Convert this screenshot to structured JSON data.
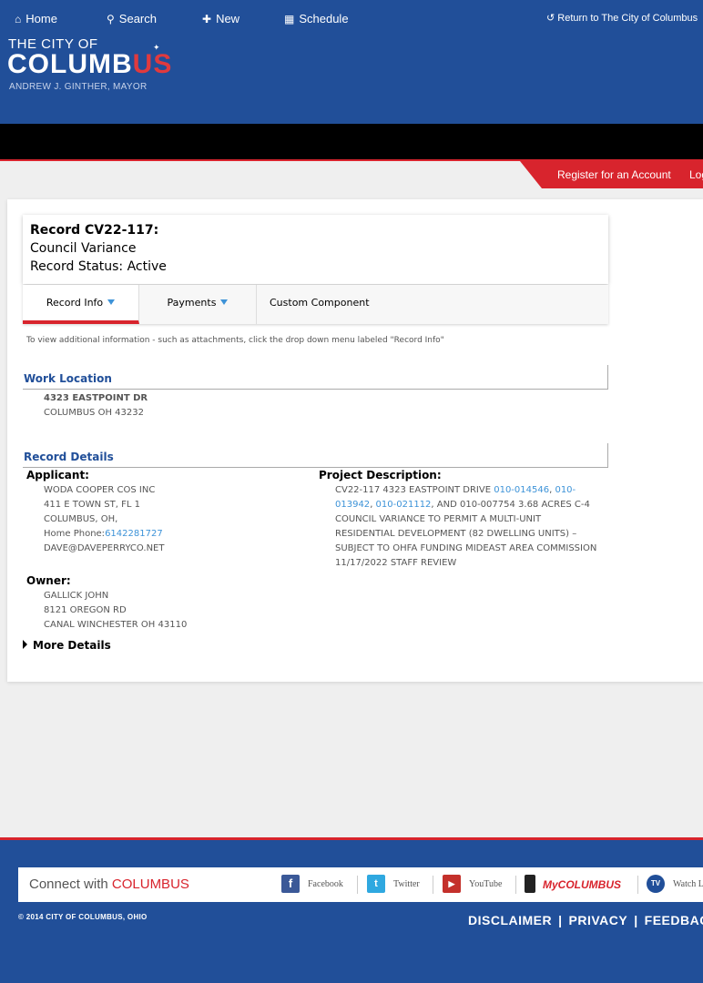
{
  "logo": {
    "line1": "THE CITY OF",
    "line2a": "COLUMB",
    "line2b": "US",
    "line3": "ANDREW J. GINTHER, MAYOR"
  },
  "nav": {
    "home": "Home",
    "search": "Search",
    "new": "New",
    "schedule": "Schedule",
    "return": "Return to The City of Columbus"
  },
  "account": {
    "register": "Register for an Account",
    "login": "Login"
  },
  "record": {
    "id": "Record CV22-117:",
    "type": "Council Variance",
    "status": "Record Status: Active"
  },
  "tabs": [
    {
      "label": "Record Info"
    },
    {
      "label": "Payments"
    },
    {
      "label": "Custom Component"
    }
  ],
  "hint": "To view additional information - such as attachments, click the drop down menu labeled \"Record Info\"",
  "work_location": {
    "heading": "Work Location",
    "line1": "4323 EASTPOINT DR",
    "line2": "COLUMBUS OH 43232"
  },
  "record_details": {
    "heading": "Record Details",
    "applicant_label": "Applicant:",
    "applicant": {
      "name": "WODA COOPER COS INC",
      "address": "411 E TOWN ST, FL 1",
      "city": "COLUMBUS, OH,",
      "phone_label": "Home Phone:",
      "phone": "6142281727",
      "email": "DAVE@DAVEPERRYCO.NET"
    },
    "owner_label": "Owner:",
    "owner": {
      "name": "GALLICK JOHN",
      "address": "8121 OREGON RD",
      "city": "CANAL WINCHESTER OH 43110"
    },
    "project_label": "Project Description:",
    "project": {
      "l1_text": "CV22-117 4323 EASTPOINT DRIVE ",
      "l1_link1": "010-014546",
      "l1_comma": ", ",
      "l1_link2a": "010-",
      "l2_link2b": "013942",
      "l2_comma": ", ",
      "l2_link3": "010-021112",
      "l2_text": ", AND 010-007754 3.68 ACRES C-4",
      "l3": "COUNCIL VARIANCE TO PERMIT A MULTI-UNIT",
      "l4": "RESIDENTIAL DEVELOPMENT (82 DWELLING UNITS) –",
      "l5": "SUBJECT TO OHFA FUNDING MIDEAST AREA COMMISSION",
      "l6": "11/17/2022 STAFF REVIEW"
    },
    "more": "More Details"
  },
  "footer": {
    "connect_prefix": "Connect with ",
    "connect_brand": "COLUMBUS",
    "facebook": "Facebook",
    "twitter": "Twitter",
    "youtube": "YouTube",
    "mycolumbus": "MyCOLUMBUS",
    "watch": "Watch Live",
    "copyright": "© 2014 CITY OF COLUMBUS, OHIO",
    "disclaimer": "DISCLAIMER",
    "privacy": "PRIVACY",
    "feedback": "FEEDBACK"
  },
  "colors": {
    "brand_blue": "#214f99",
    "brand_red": "#d8242d",
    "link_blue": "#3d93d8"
  }
}
